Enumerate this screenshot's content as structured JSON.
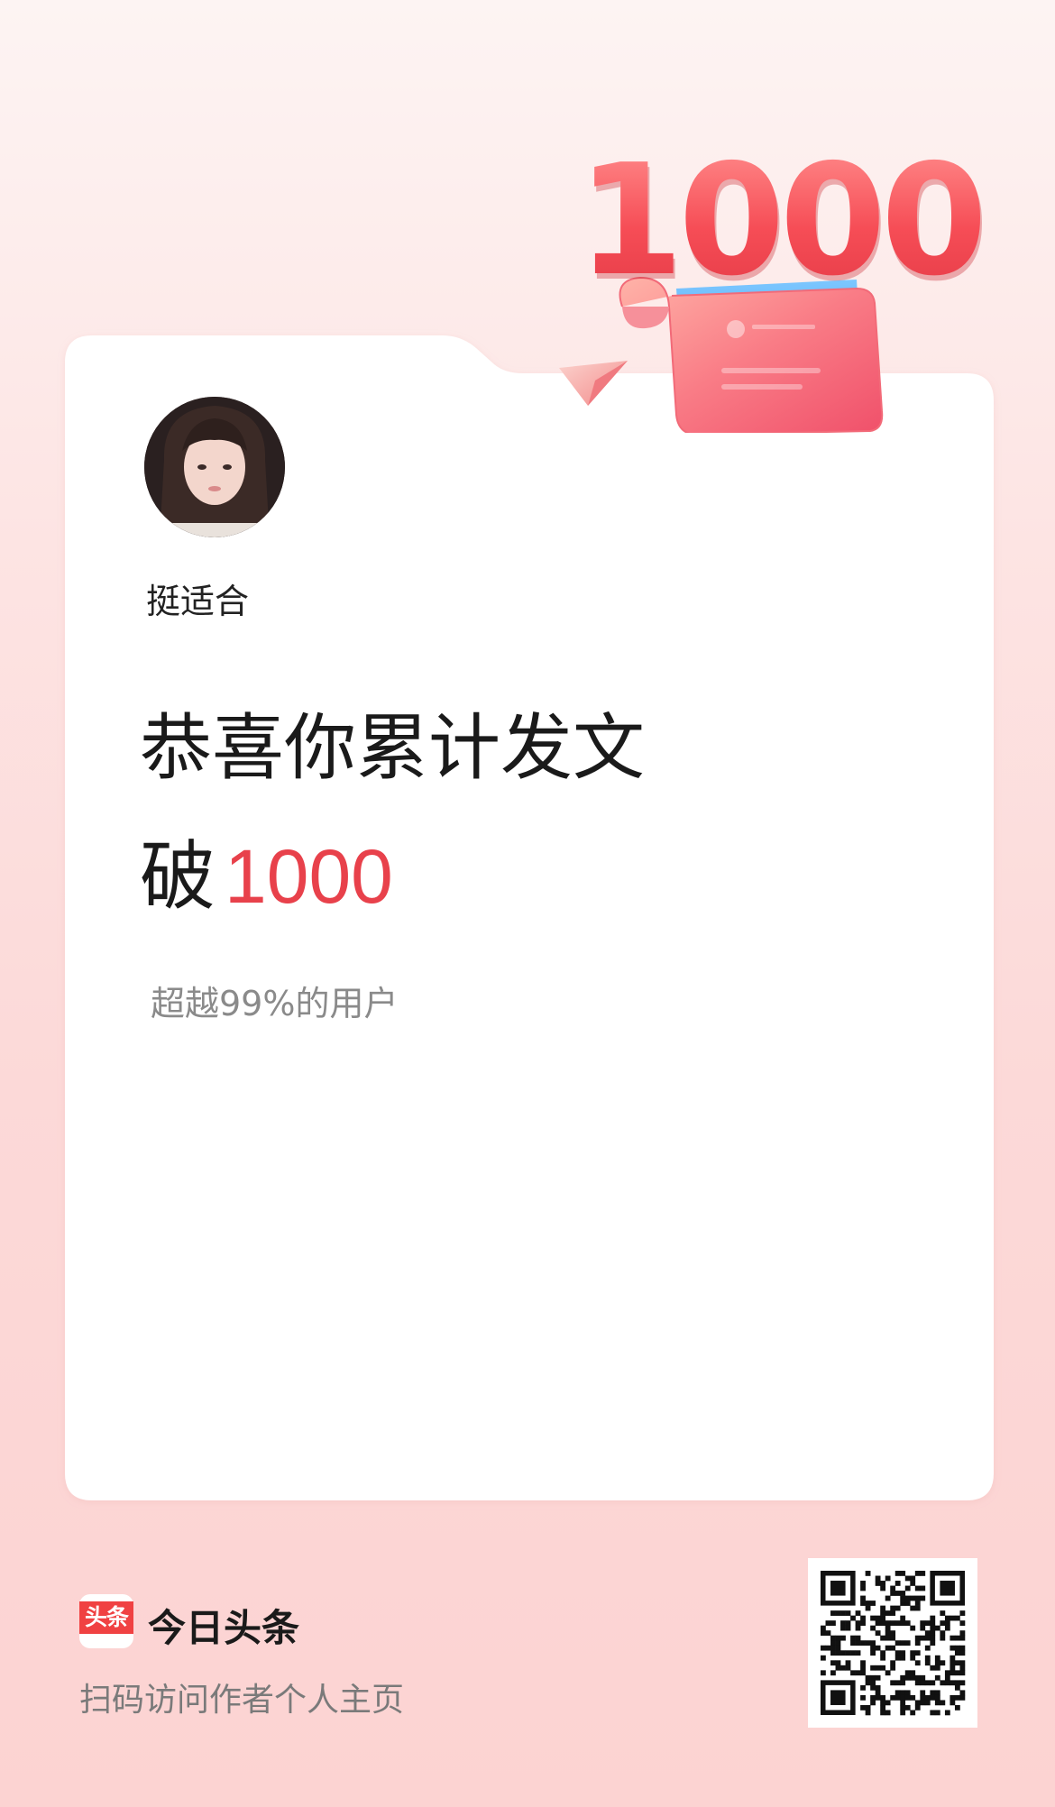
{
  "profile": {
    "username": "挺适合"
  },
  "headline": {
    "line1": "恭喜你累计发文",
    "line2_prefix": "破",
    "line2_number": "1000"
  },
  "rank": {
    "text": "超越99%的用户"
  },
  "badge": {
    "number": "1000",
    "icon": "paper-plane-scroll-icon"
  },
  "footer": {
    "brand_logo_text": "头条",
    "brand_name": "今日头条",
    "tip": "扫码访问作者个人主页",
    "qr_icon": "qr-code-icon"
  },
  "colors": {
    "accent": "#e8414b",
    "background_top": "#fdf4f3",
    "background_bottom": "#fcd3d2",
    "card": "#ffffff",
    "brand_red": "#f04142"
  }
}
